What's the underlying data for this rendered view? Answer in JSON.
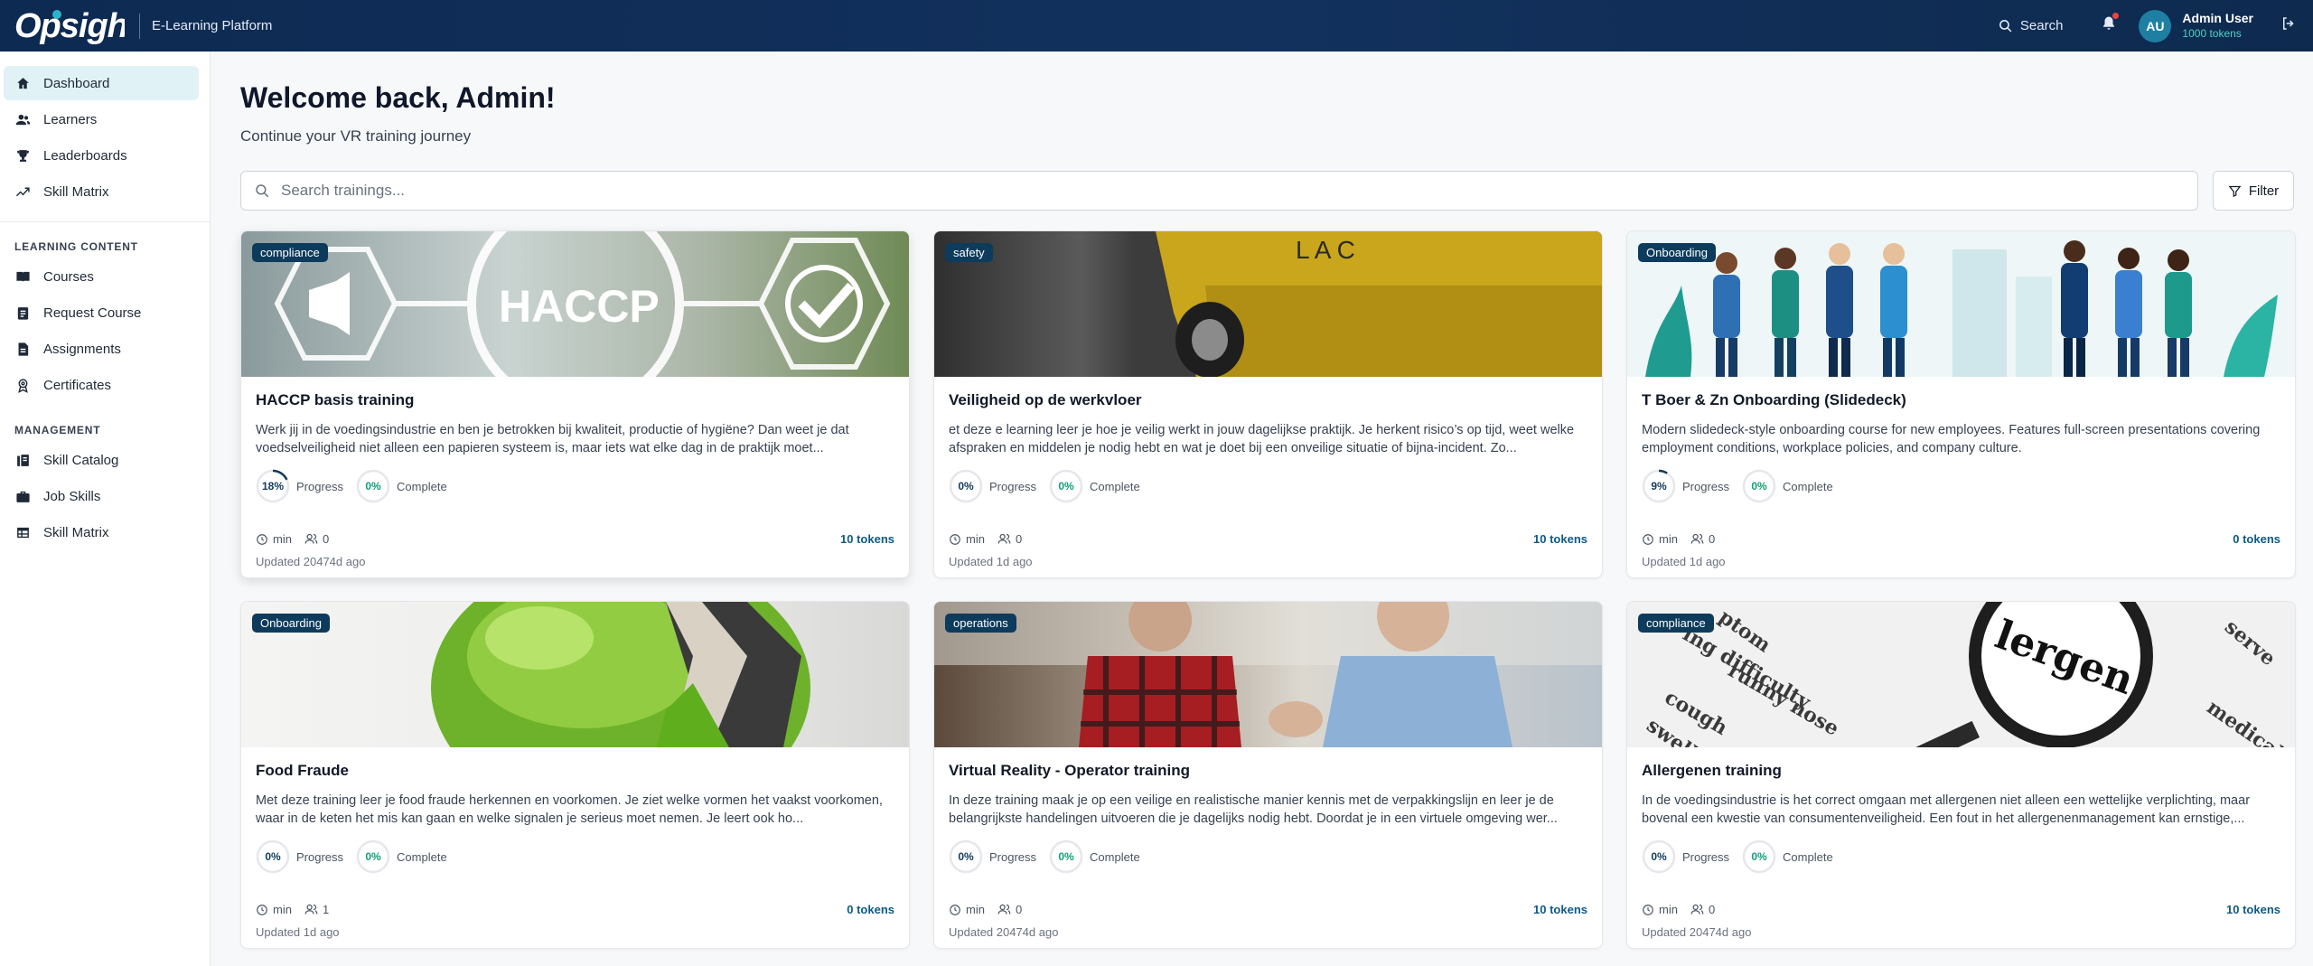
{
  "header": {
    "logo": "Opsight",
    "platform_name": "E-Learning Platform",
    "search_label": "Search",
    "user_initials": "AU",
    "user_name": "Admin User",
    "user_tokens": "1000 tokens"
  },
  "sidebar": {
    "items": [
      {
        "label": "Dashboard",
        "icon": "home-icon",
        "active": true
      },
      {
        "label": "Learners",
        "icon": "users-icon"
      },
      {
        "label": "Leaderboards",
        "icon": "trophy-icon"
      },
      {
        "label": "Skill Matrix",
        "icon": "trend-icon"
      }
    ],
    "learning_heading": "LEARNING CONTENT",
    "learning_items": [
      {
        "label": "Courses",
        "icon": "book-icon"
      },
      {
        "label": "Request Course",
        "icon": "clipboard-icon"
      },
      {
        "label": "Assignments",
        "icon": "file-icon"
      },
      {
        "label": "Certificates",
        "icon": "award-icon"
      }
    ],
    "management_heading": "MANAGEMENT",
    "management_items": [
      {
        "label": "Skill Catalog",
        "icon": "library-icon"
      },
      {
        "label": "Job Skills",
        "icon": "briefcase-icon"
      },
      {
        "label": "Skill Matrix",
        "icon": "table-icon"
      }
    ]
  },
  "main": {
    "welcome": "Welcome back, Admin!",
    "subtitle": "Continue your VR training journey",
    "search_placeholder": "Search trainings...",
    "filter_label": "Filter",
    "progress_label": "Progress",
    "complete_label": "Complete",
    "min_label": "min",
    "cards": [
      {
        "tag": "compliance",
        "title": "HACCP basis training",
        "description": "Werk jij in de voedingsindustrie en ben je betrokken bij kwaliteit, productie of hygiëne? Dan weet je dat voedselveiligheid niet alleen een papieren systeem is, maar iets wat elke dag in de praktijk moet...",
        "progress": "18%",
        "progress_value": 18,
        "complete": "0%",
        "users": "0",
        "tokens": "10 tokens",
        "updated": "Updated 20474d ago",
        "image_text": "HACCP"
      },
      {
        "tag": "safety",
        "title": "Veiligheid op de werkvloer",
        "description": "et deze e learning leer je hoe je veilig werkt in jouw dagelijkse praktijk. Je herkent risico’s op tijd, weet welke afspraken en middelen je nodig hebt en wat je doet bij een onveilige situatie of bijna-incident. Zo...",
        "progress": "0%",
        "progress_value": 0,
        "complete": "0%",
        "users": "0",
        "tokens": "10 tokens",
        "updated": "Updated 1d ago",
        "image_text": "L A C"
      },
      {
        "tag": "Onboarding",
        "title": "T Boer & Zn Onboarding (Slidedeck)",
        "description": "Modern slidedeck-style onboarding course for new employees. Features full-screen presentations covering employment conditions, workplace policies, and company culture.",
        "progress": "9%",
        "progress_value": 9,
        "complete": "0%",
        "users": "0",
        "tokens": "0 tokens",
        "updated": "Updated 1d ago",
        "image_text": ""
      },
      {
        "tag": "Onboarding",
        "title": "Food Fraude",
        "description": "Met deze training leer je food fraude herkennen en voorkomen. Je ziet welke vormen het vaakst voorkomen, waar in de keten het mis kan gaan en welke signalen je serieus moet nemen. Je leert ook ho...",
        "progress": "0%",
        "progress_value": 0,
        "complete": "0%",
        "users": "1",
        "tokens": "0 tokens",
        "updated": "Updated 1d ago",
        "image_text": ""
      },
      {
        "tag": "operations",
        "title": "Virtual Reality - Operator training",
        "description": "In deze training maak je op een veilige en realistische manier kennis met de verpakkingslijn en leer je de belangrijkste handelingen uitvoeren die je dagelijks nodig hebt. Doordat je in een virtuele omgeving wer...",
        "progress": "0%",
        "progress_value": 0,
        "complete": "0%",
        "users": "0",
        "tokens": "10 tokens",
        "updated": "Updated 20474d ago",
        "image_text": ""
      },
      {
        "tag": "compliance",
        "title": "Allergenen training",
        "description": "In de voedingsindustrie is het correct omgaan met allergenen niet alleen een wettelijke verplichting, maar bovenal een kwestie van consumentenveiligheid. Een fout in het allergenenmanagement kan ernstige,...",
        "progress": "0%",
        "progress_value": 0,
        "complete": "0%",
        "users": "0",
        "tokens": "10 tokens",
        "updated": "Updated 20474d ago",
        "image_text": "lergen"
      }
    ]
  },
  "colors": {
    "header_bg": "#0d2a52",
    "accent": "#0e5a83",
    "badge_bg": "#0d3b5c",
    "active_nav": "#e0f2f5",
    "complete_green": "#0f9f7a"
  }
}
